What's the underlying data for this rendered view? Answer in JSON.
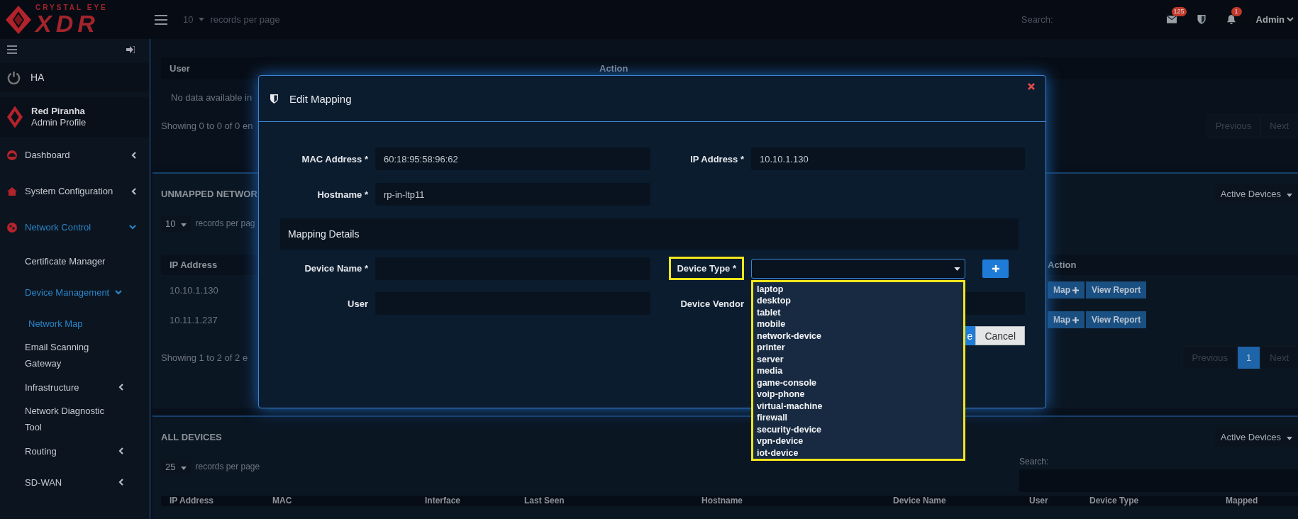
{
  "header": {
    "logo_tagline": "CRYSTAL EYE",
    "logo_text": "XDR",
    "records_value": "10",
    "records_label": "records per page",
    "search_label": "Search:",
    "mail_count": "125",
    "alert_count": "1",
    "user": "Admin"
  },
  "sidebar": {
    "ha": "HA",
    "profile": {
      "name": "Red Piranha",
      "role": "Admin Profile"
    },
    "items": [
      {
        "label": "Dashboard",
        "kind": "group",
        "expanded": false
      },
      {
        "label": "System Configuration",
        "kind": "group",
        "expanded": false
      },
      {
        "label": "Network Control",
        "kind": "group",
        "expanded": true,
        "children": [
          {
            "label": "Certificate Manager",
            "kind": "link",
            "selected": false
          },
          {
            "label": "Device Management",
            "kind": "group",
            "expanded": true,
            "children": [
              {
                "label": "Network Map",
                "kind": "link",
                "selected": true
              }
            ]
          },
          {
            "label": "Email Scanning Gateway",
            "kind": "link",
            "selected": false
          },
          {
            "label": "Infrastructure",
            "kind": "group",
            "expanded": false
          },
          {
            "label": "Network Diagnostic Tool",
            "kind": "link",
            "selected": false
          },
          {
            "label": "Routing",
            "kind": "group",
            "expanded": false
          },
          {
            "label": "SD-WAN",
            "kind": "group",
            "expanded": false
          }
        ]
      }
    ]
  },
  "users_card": {
    "columns": [
      "User",
      "Action"
    ],
    "empty_text": "No data available in",
    "info": "Showing 0 to 0 of 0 en",
    "pagination": [
      {
        "label": "Previous",
        "selected": false
      },
      {
        "label": "Next",
        "selected": false
      }
    ]
  },
  "unmapped_card": {
    "title": "UNMAPPED NETWOR",
    "filter": "Active Devices",
    "records_value": "10",
    "records_label": "records per pag",
    "columns": [
      "IP Address",
      "Action"
    ],
    "rows": [
      {
        "ip": "10.10.1.130",
        "map": "Map",
        "report": "View Report"
      },
      {
        "ip": "10.11.1.237",
        "map": "Map",
        "report": "View Report"
      }
    ],
    "info": "Showing 1 to 2 of 2 e",
    "pagination": [
      {
        "label": "Previous",
        "selected": false
      },
      {
        "label": "1",
        "selected": true
      },
      {
        "label": "Next",
        "selected": false
      }
    ]
  },
  "all_devices_card": {
    "title": "ALL DEVICES",
    "filter": "Active Devices",
    "records_value": "25",
    "records_label": "records per page",
    "search_label": "Search:",
    "columns": [
      "IP Address",
      "MAC",
      "Interface",
      "Last Seen",
      "Hostname",
      "Device Name",
      "User",
      "Device Type",
      "Mapped"
    ]
  },
  "modal": {
    "title": "Edit Mapping",
    "mac": {
      "label": "MAC Address *",
      "value": "60:18:95:58:96:62"
    },
    "ip": {
      "label": "IP Address *",
      "value": "10.10.1.130"
    },
    "hostname": {
      "label": "Hostname *",
      "value": "rp-in-ltp11"
    },
    "section": "Mapping Details",
    "device_name": {
      "label": "Device Name *"
    },
    "user": {
      "label": "User"
    },
    "device_vendor": {
      "label": "Device Vendor"
    },
    "device_type": {
      "label": "Device Type *",
      "highlighted": true,
      "open": true,
      "options": [
        {
          "label": "laptop",
          "selected": false
        },
        {
          "label": "desktop",
          "selected": false
        },
        {
          "label": "tablet",
          "selected": false
        },
        {
          "label": "mobile",
          "selected": false
        },
        {
          "label": "network-device",
          "selected": false
        },
        {
          "label": "printer",
          "selected": false
        },
        {
          "label": "server",
          "selected": false
        },
        {
          "label": "media",
          "selected": false
        },
        {
          "label": "game-console",
          "selected": false
        },
        {
          "label": "voip-phone",
          "selected": false
        },
        {
          "label": "virtual-machine",
          "selected": false
        },
        {
          "label": "firewall",
          "selected": false
        },
        {
          "label": "security-device",
          "selected": false
        },
        {
          "label": "vpn-device",
          "selected": false
        },
        {
          "label": "iot-device",
          "selected": false
        }
      ]
    },
    "save_label": "e",
    "cancel_label": "Cancel"
  }
}
